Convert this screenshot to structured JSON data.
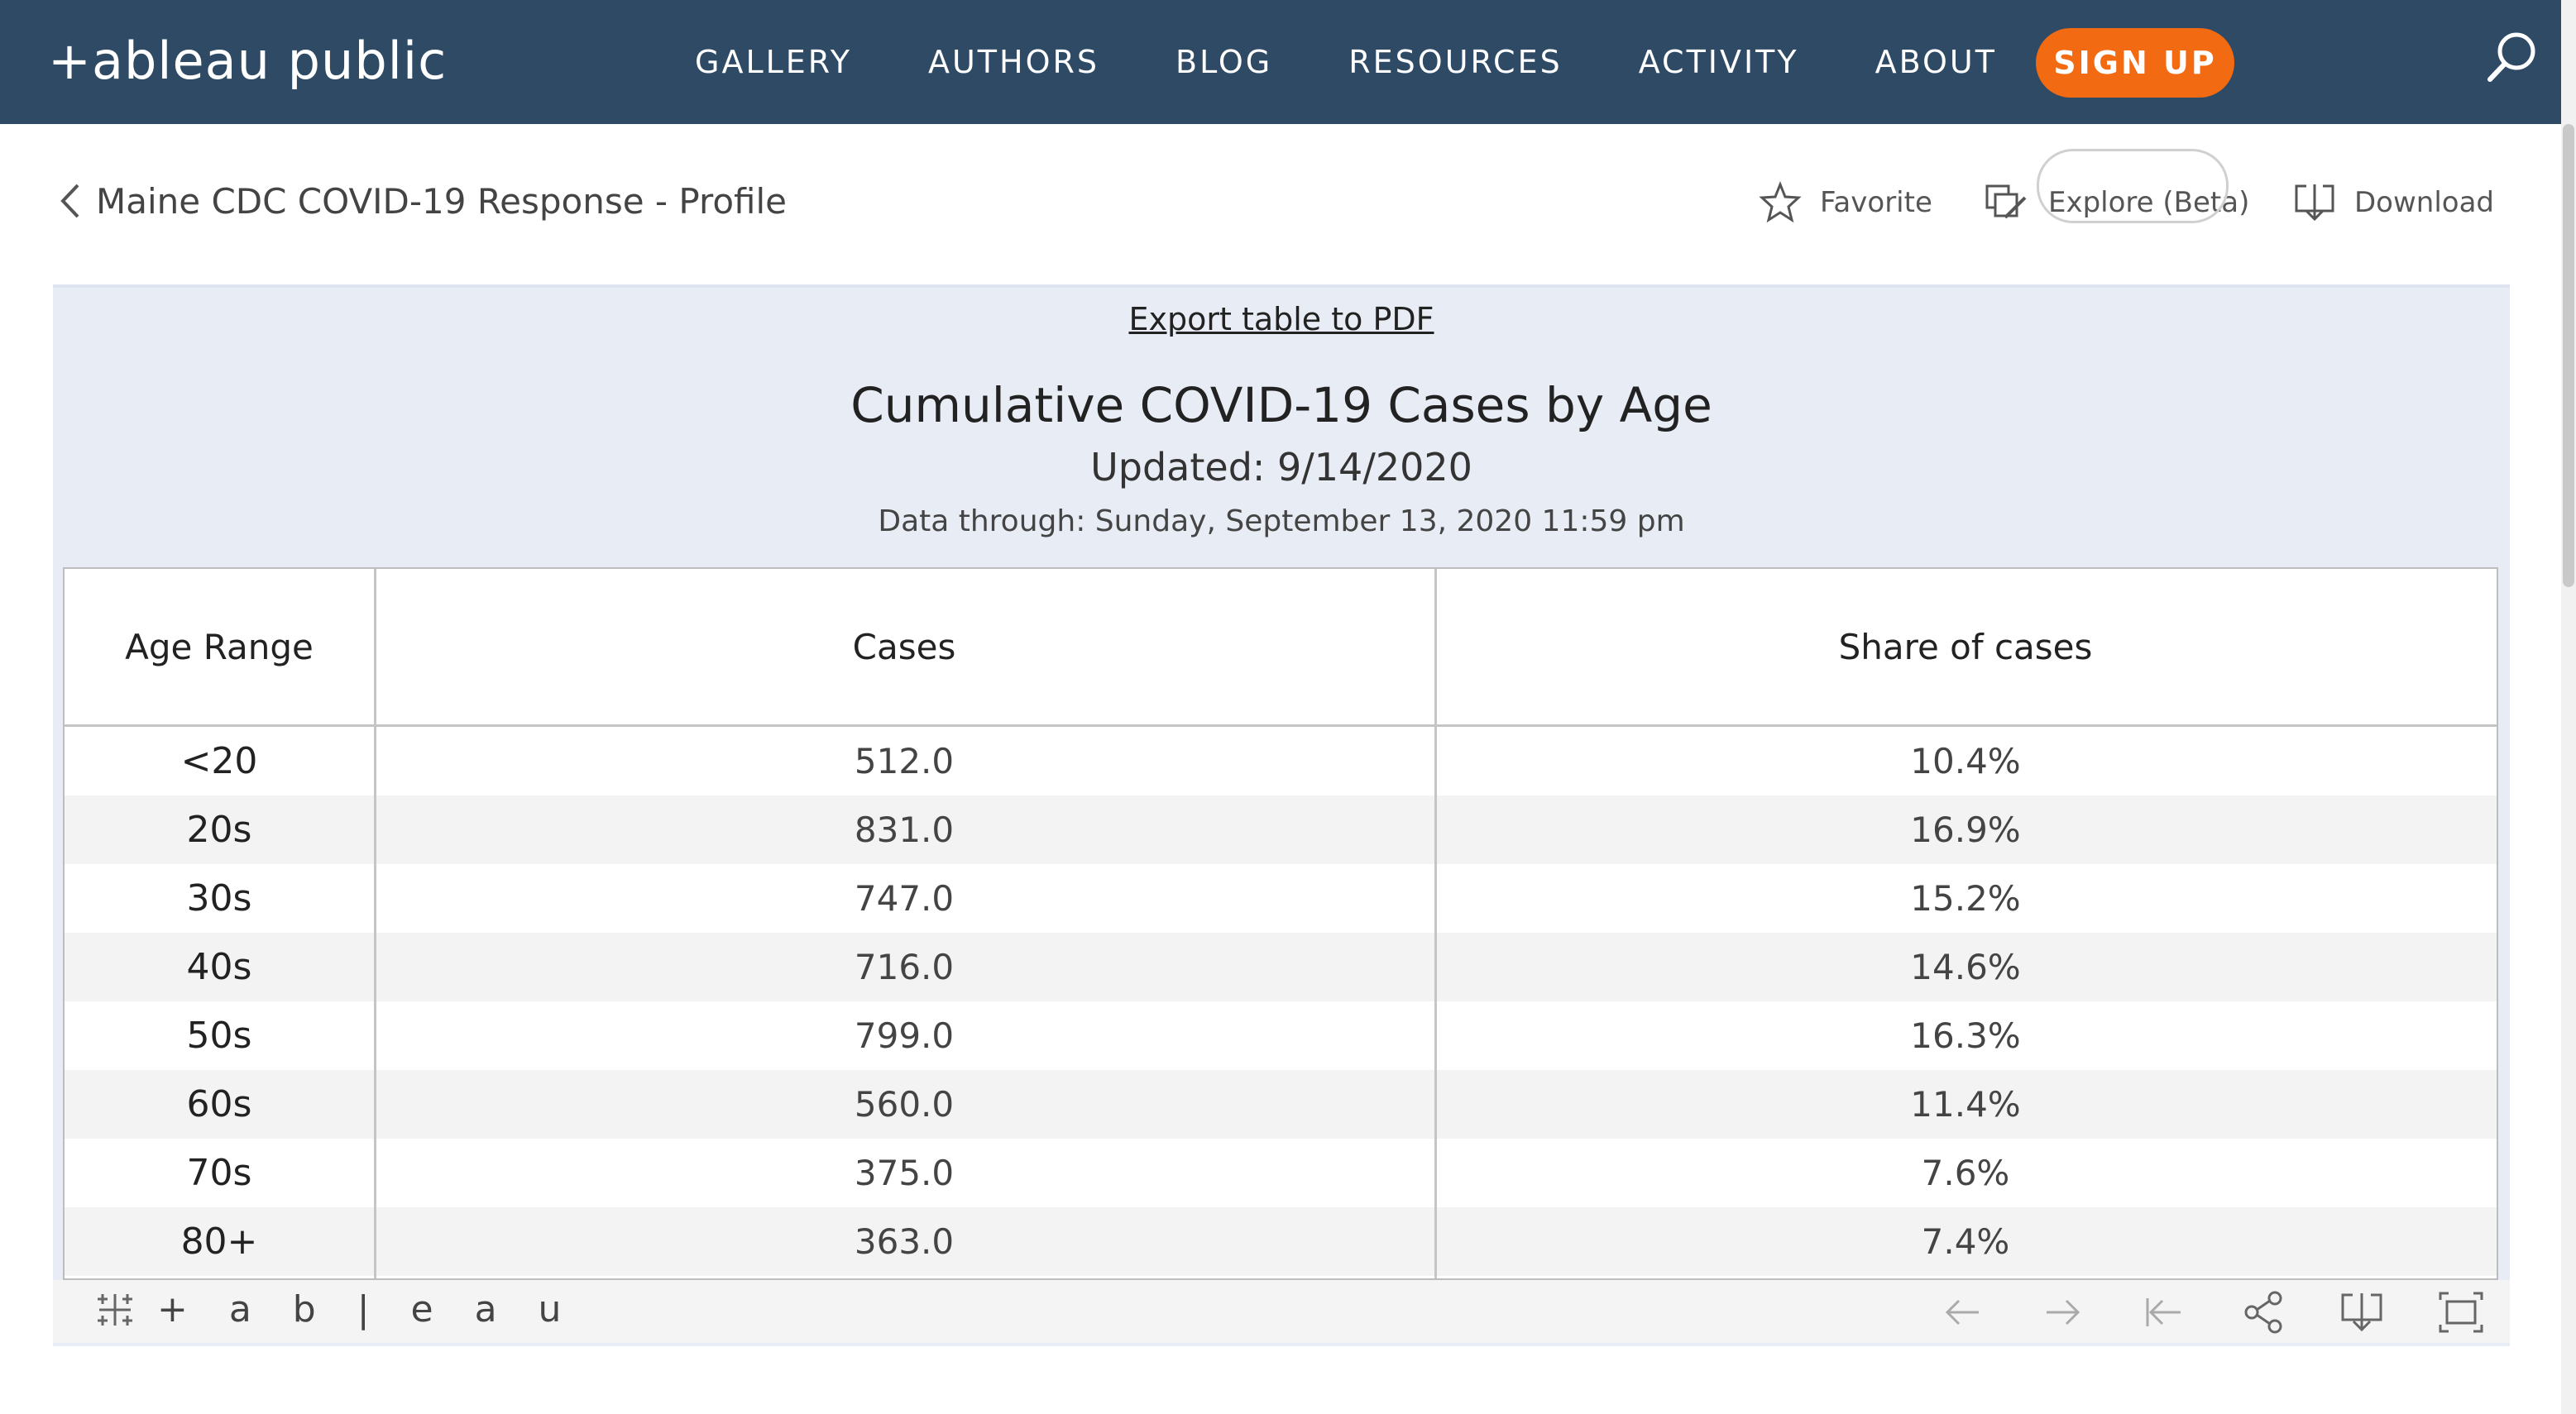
{
  "header": {
    "logo_text": "+ableau public",
    "nav": [
      "GALLERY",
      "AUTHORS",
      "BLOG",
      "RESOURCES",
      "ACTIVITY",
      "ABOUT"
    ],
    "signup_label": "SIGN UP"
  },
  "breadcrumb": {
    "back_label": "Maine CDC COVID-19 Response - Profile"
  },
  "actions": {
    "favorite": "Favorite",
    "explore": "Explore (Beta)",
    "download": "Download"
  },
  "viz": {
    "export_label": "Export table to PDF",
    "title": "Cumulative COVID-19 Cases by Age",
    "updated": "Updated: 9/14/2020",
    "data_through": "Data through: Sunday, September 13, 2020 11:59 pm",
    "columns": [
      "Age Range",
      "Cases",
      "Share of cases"
    ],
    "rows": [
      [
        "<20",
        "512.0",
        "10.4%"
      ],
      [
        "20s",
        "831.0",
        "16.9%"
      ],
      [
        "30s",
        "747.0",
        "15.2%"
      ],
      [
        "40s",
        "716.0",
        "14.6%"
      ],
      [
        "50s",
        "799.0",
        "16.3%"
      ],
      [
        "60s",
        "560.0",
        "11.4%"
      ],
      [
        "70s",
        "375.0",
        "7.6%"
      ],
      [
        "80+",
        "363.0",
        "7.4%"
      ]
    ]
  },
  "footer": {
    "tableau_label": "+ a b | e a u"
  },
  "colors": {
    "nav_bg": "#2f4a65",
    "signup": "#f26a12",
    "viz_bg": "#e8ecf4"
  }
}
